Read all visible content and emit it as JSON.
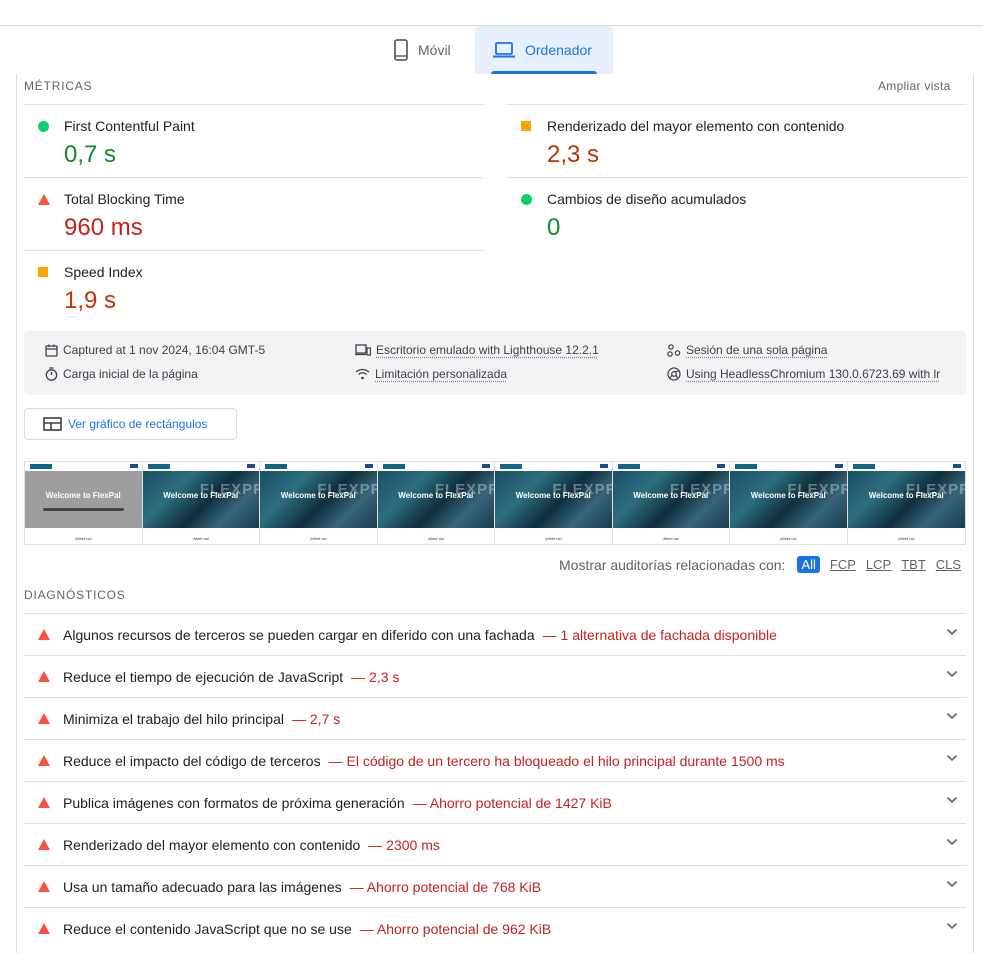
{
  "tabs": {
    "movil": "Móvil",
    "ordenador": "Ordenador"
  },
  "metrics_section": {
    "label": "MÉTRICAS",
    "expand": "Ampliar vista"
  },
  "metrics": [
    {
      "label": "First Contentful Paint",
      "value": "0,7 s",
      "status": "pass"
    },
    {
      "label": "Renderizado del mayor elemento con contenido",
      "value": "2,3 s",
      "status": "average"
    },
    {
      "label": "Total Blocking Time",
      "value": "960 ms",
      "status": "fail"
    },
    {
      "label": "Cambios de diseño acumulados",
      "value": "0",
      "status": "pass"
    },
    {
      "label": "Speed Index",
      "value": "1,9 s",
      "status": "average"
    }
  ],
  "info": {
    "captured": "Captured at 1 nov 2024, 16:04 GMT-5",
    "emulated": "Escritorio emulado with Lighthouse 12.2.1",
    "session": "Sesión de una sola página",
    "load": "Carga inicial de la página",
    "throttling": "Limitación personalizada",
    "browser": "Using HeadlessChromium 130.0.6723.69 with lr"
  },
  "treemap_button": "Ver gráfico de rectángulos",
  "filmstrip": {
    "hero_title": "Welcome to FlexPal",
    "overlay_text": "FLEXPR",
    "footer_text": "¡Meet us!"
  },
  "filters": {
    "label": "Mostrar auditorías relacionadas con:",
    "options": [
      "All",
      "FCP",
      "LCP",
      "TBT",
      "CLS"
    ],
    "selected": "All"
  },
  "diagnostics": {
    "label": "DIAGNÓSTICOS",
    "items": [
      {
        "title": "Algunos recursos de terceros se pueden cargar en diferido con una fachada",
        "display": "— 1 alternativa de fachada disponible"
      },
      {
        "title": "Reduce el tiempo de ejecución de JavaScript",
        "display": "— 2,3 s"
      },
      {
        "title": "Minimiza el trabajo del hilo principal",
        "display": "— 2,7 s"
      },
      {
        "title": "Reduce el impacto del código de terceros",
        "display": "— El código de un tercero ha bloqueado el hilo principal durante 1500 ms"
      },
      {
        "title": "Publica imágenes con formatos de próxima generación",
        "display": "— Ahorro potencial de 1427 KiB"
      },
      {
        "title": "Renderizado del mayor elemento con contenido",
        "display": "— 2300 ms"
      },
      {
        "title": "Usa un tamaño adecuado para las imágenes",
        "display": "— Ahorro potencial de 768 KiB"
      },
      {
        "title": "Reduce el contenido JavaScript que no se use",
        "display": "— Ahorro potencial de 962 KiB"
      }
    ]
  },
  "colors": {
    "accent": "#1a73e8",
    "pass": "#0cce6b",
    "average": "#ffa400",
    "fail": "#ff4e42"
  }
}
